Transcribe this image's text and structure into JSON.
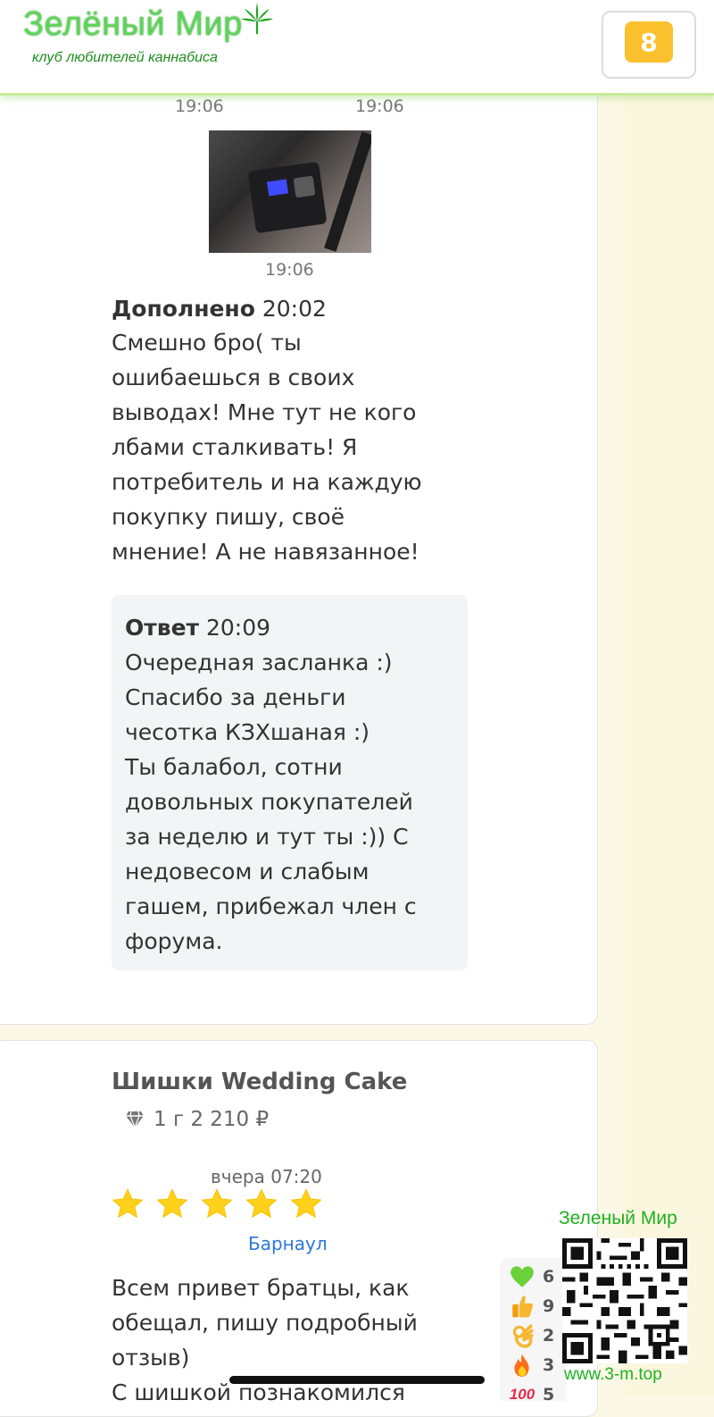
{
  "header": {
    "logo_title": "Зелёный Мир",
    "logo_subtitle": "клуб любителей каннабиса",
    "notification_count": "8"
  },
  "thread": {
    "time_left": "19:06",
    "time_right": "19:06",
    "photo_time": "19:06",
    "addition": {
      "label": "Дополнено",
      "time": "20:02",
      "text": "Смешно бро( ты\nошибаешься в своих\nвыводах! Мне тут не кого\nлбами сталкивать! Я\nпотребитель и на каждую\nпокупку пишу, своё\nмнение! А не навязанное!"
    },
    "reply": {
      "label": "Ответ",
      "time": "20:09",
      "text": "Очередная засланка :)\nСпасибо за деньги\nчесотка КЗХшаная :)\nТы балабол, сотни\nдовольных покупателей\nза неделю и тут ты :)) С\nнедовесом и слабым\nгашем, прибежал член с\nфорума."
    }
  },
  "review": {
    "product_title": "Шишки Wedding Cake",
    "price": "1 г 2 210 ₽",
    "time": "вчера 07:20",
    "rating": 5,
    "city": "Барнаул",
    "text": "Всем привет братцы, как\nобещал, пишу подробный\nотзыв)\nС шишкой познакомился"
  },
  "reactions": [
    {
      "icon": "green-heart-icon",
      "count": "6"
    },
    {
      "icon": "thumbs-up-icon",
      "count": "9"
    },
    {
      "icon": "ok-hand-icon",
      "count": "2"
    },
    {
      "icon": "fire-icon",
      "count": "3"
    },
    {
      "icon": "hundred-icon",
      "count": "5"
    }
  ],
  "watermark": {
    "title": "Зеленый Мир",
    "url": "www.3-m.top"
  },
  "colors": {
    "accent_green": "#5fd35a",
    "badge_yellow": "#fbc02d",
    "link_blue": "#2b78d6",
    "star_yellow": "#ffd11a"
  }
}
